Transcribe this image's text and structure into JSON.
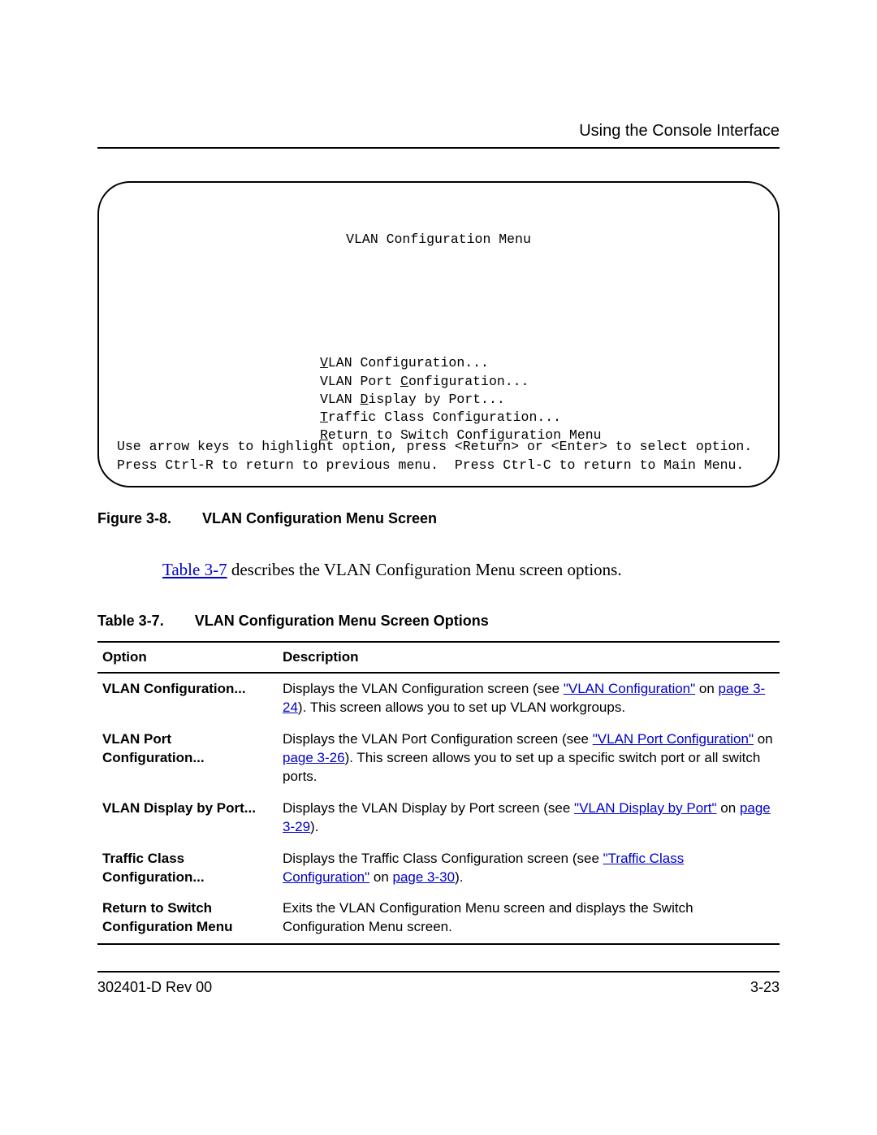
{
  "chapter_title": "Using the Console Interface",
  "console": {
    "title": "VLAN Configuration Menu",
    "items": [
      {
        "pre": "",
        "hot": "V",
        "rest": "LAN Configuration..."
      },
      {
        "pre": "VLAN Port ",
        "hot": "C",
        "rest": "onfiguration..."
      },
      {
        "pre": "VLAN ",
        "hot": "D",
        "rest": "isplay by Port..."
      },
      {
        "pre": "",
        "hot": "T",
        "rest": "raffic Class Configuration..."
      },
      {
        "pre": "",
        "hot": "R",
        "rest": "eturn to Switch Configuration Menu"
      }
    ],
    "footer1": "Use arrow keys to highlight option, press <Return> or <Enter> to select option.",
    "footer2": "Press Ctrl-R to return to previous menu.  Press Ctrl-C to return to Main Menu."
  },
  "figure": {
    "label": "Figure 3-8.",
    "title": "VLAN Configuration Menu Screen"
  },
  "paragraph": {
    "xref": "Table 3-7",
    "rest": " describes the VLAN Configuration Menu screen options."
  },
  "table": {
    "label": "Table 3-7.",
    "title": "VLAN Configuration Menu Screen Options",
    "head_option": "Option",
    "head_desc": "Description",
    "rows": [
      {
        "option": "VLAN Configuration...",
        "d1": "Displays the VLAN Configuration screen (see ",
        "l1": "\"VLAN Configuration\"",
        "d2": " on ",
        "l2": "page 3-24",
        "d3": "). This screen allows you to set up VLAN workgroups."
      },
      {
        "option": "VLAN Port Configuration...",
        "d1": "Displays the VLAN Port Configuration screen (see ",
        "l1": "\"VLAN Port Configuration\"",
        "d2": " on ",
        "l2": "page 3-26",
        "d3": "). This screen allows you to set up a specific switch port or all switch ports."
      },
      {
        "option": "VLAN Display by Port...",
        "d1": "Displays the VLAN Display by Port screen (see ",
        "l1": "\"VLAN Display by Port\"",
        "d2": " on ",
        "l2": "page 3-29",
        "d3": ")."
      },
      {
        "option": "Traffic Class Configuration...",
        "d1": "Displays the Traffic Class Configuration screen (see ",
        "l1": "\"Traffic Class Configuration\"",
        "d2": " on ",
        "l2": "page 3-30",
        "d3": ")."
      },
      {
        "option": "Return to Switch Configuration Menu",
        "d1": "Exits the VLAN Configuration Menu screen and displays the Switch Configuration Menu screen.",
        "l1": "",
        "d2": "",
        "l2": "",
        "d3": ""
      }
    ]
  },
  "footer": {
    "left": "302401-D Rev 00",
    "right": "3-23"
  }
}
